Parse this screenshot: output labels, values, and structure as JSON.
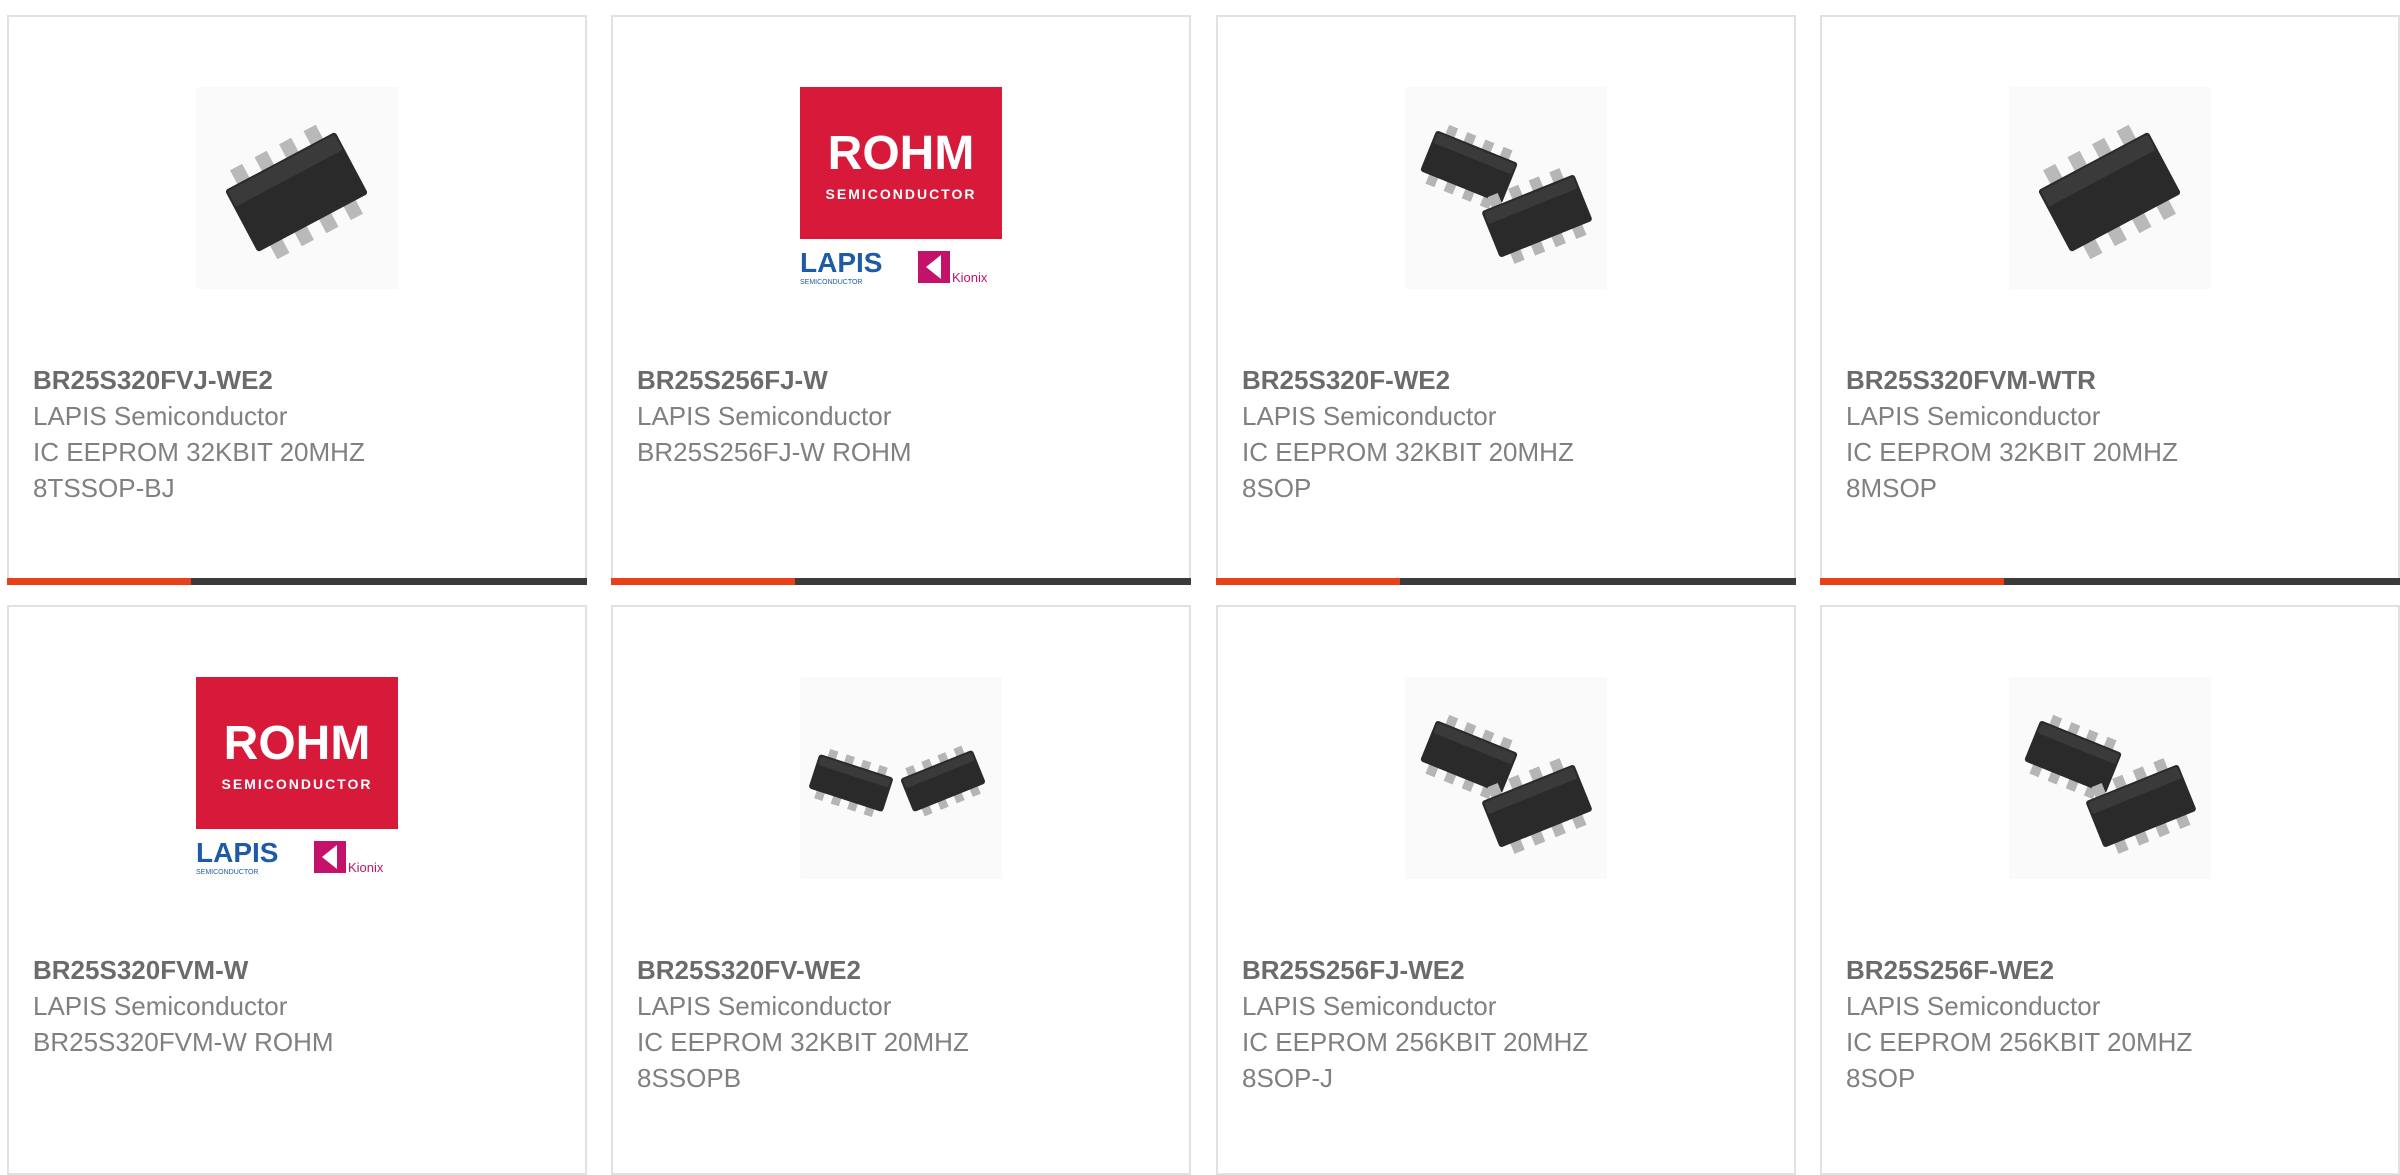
{
  "colors": {
    "accent": "#e8411a",
    "bar": "#3b3b3b",
    "rohm_red": "#d7193a",
    "lapis_blue": "#1e5aa8",
    "kionix_pink": "#c4126a"
  },
  "products": [
    {
      "part": "BR25S320FVJ-WE2",
      "manufacturer": "LAPIS Semiconductor",
      "desc": [
        "IC EEPROM 32KBIT 20MHZ",
        "8TSSOP-BJ"
      ],
      "image": "chip-icon",
      "active": true
    },
    {
      "part": "BR25S256FJ-W",
      "manufacturer": "LAPIS Semiconductor",
      "desc": [
        "BR25S256FJ-W ROHM",
        ""
      ],
      "image": "rohm-logo",
      "active": true
    },
    {
      "part": "BR25S320F-WE2",
      "manufacturer": "LAPIS Semiconductor",
      "desc": [
        "IC EEPROM 32KBIT 20MHZ",
        "8SOP"
      ],
      "image": "chip-pair-icon",
      "active": true
    },
    {
      "part": "BR25S320FVM-WTR",
      "manufacturer": "LAPIS Semiconductor",
      "desc": [
        "IC EEPROM 32KBIT 20MHZ",
        "8MSOP"
      ],
      "image": "chip-icon",
      "active": true
    },
    {
      "part": "BR25S320FVM-W",
      "manufacturer": "LAPIS Semiconductor",
      "desc": [
        "BR25S320FVM-W ROHM",
        ""
      ],
      "image": "rohm-logo",
      "active": false
    },
    {
      "part": "BR25S320FV-WE2",
      "manufacturer": "LAPIS Semiconductor",
      "desc": [
        "IC EEPROM 32KBIT 20MHZ",
        "8SSOPB"
      ],
      "image": "chip-pair-small-icon",
      "active": false
    },
    {
      "part": "BR25S256FJ-WE2",
      "manufacturer": "LAPIS Semiconductor",
      "desc": [
        "IC EEPROM 256KBIT 20MHZ",
        "8SOP-J"
      ],
      "image": "chip-pair-icon",
      "active": false
    },
    {
      "part": "BR25S256F-WE2",
      "manufacturer": "LAPIS Semiconductor",
      "desc": [
        "IC EEPROM 256KBIT 20MHZ",
        "8SOP"
      ],
      "image": "chip-pair-icon",
      "active": false
    }
  ],
  "logo": {
    "brand": "ROHM",
    "sub": "SEMICONDUCTOR",
    "lapis": "LAPIS",
    "lapis_sub": "SEMICONDUCTOR",
    "kionix": "Kionix"
  }
}
